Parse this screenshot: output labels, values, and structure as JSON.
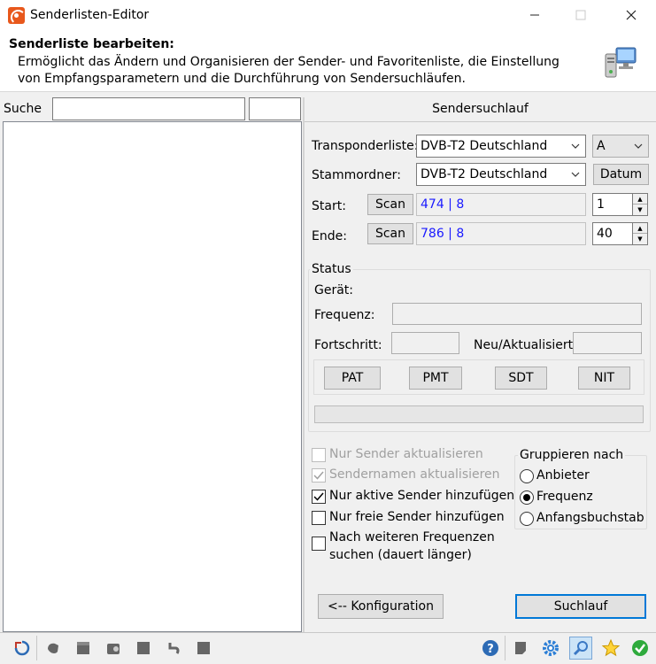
{
  "window": {
    "title": "Senderlisten-Editor"
  },
  "header": {
    "title": "Senderliste bearbeiten:",
    "description": "Ermöglicht das Ändern und Organisieren der Sender- und Favoritenliste, die Einstellung von Empfangsparametern und die Durchführung von Sendersuchläufen."
  },
  "left": {
    "search_label": "Suche",
    "search_value": "",
    "search_value2": ""
  },
  "right": {
    "section_title": "Sendersuchlauf",
    "transponder_label": "Transponderliste:",
    "transponder_value": "DVB-T2 Deutschland",
    "transponder_sub_value": "A",
    "stammordner_label": "Stammordner:",
    "stammordner_value": "DVB-T2 Deutschland",
    "datum_button": "Datum",
    "start_label": "Start:",
    "start_scan": "Scan",
    "start_value": "474 | 8",
    "start_spin": "1",
    "ende_label": "Ende:",
    "ende_scan": "Scan",
    "ende_value": "786 | 8",
    "ende_spin": "40"
  },
  "status": {
    "title": "Status",
    "geraet_label": "Gerät:",
    "frequenz_label": "Frequenz:",
    "fortschritt_label": "Fortschritt:",
    "neu_label": "Neu/Aktualisiert:",
    "buttons": [
      "PAT",
      "PMT",
      "SDT",
      "NIT"
    ]
  },
  "options": {
    "nur_sender_aktualisieren": "Nur Sender aktualisieren",
    "sendernamen_aktualisieren": "Sendernamen aktualisieren",
    "nur_aktive": "Nur aktive Sender hinzufügen",
    "nur_freie": "Nur freie Sender hinzufügen",
    "weitere_freq_1": "Nach weiteren Frequenzen",
    "weitere_freq_2": "suchen (dauert länger)"
  },
  "gruppieren": {
    "title": "Gruppieren nach",
    "anbieter": "Anbieter",
    "frequenz": "Frequenz",
    "anfang": "Anfangsbuchstabe"
  },
  "buttons": {
    "konfiguration": "<-- Konfiguration",
    "suchlauf": "Suchlauf"
  },
  "colors": {
    "link_blue": "#1a1aff",
    "app_icon": "#e8581c"
  }
}
